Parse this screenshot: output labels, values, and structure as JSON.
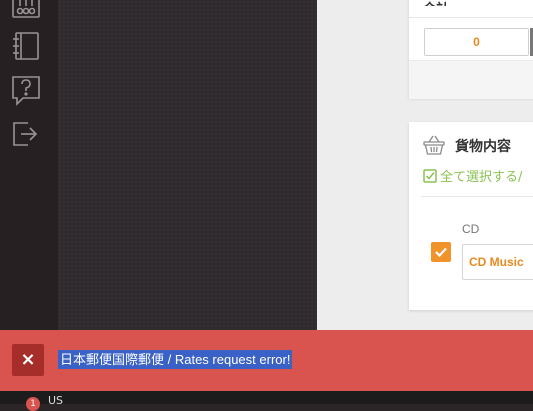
{
  "sidebar": {
    "icons": [
      "settings-sliders-icon",
      "notebook-icon",
      "help-question-icon",
      "logout-icon"
    ]
  },
  "panel_top": {
    "title_partial": "合計",
    "quantity_value": "0"
  },
  "cargo": {
    "title": "貨物内容",
    "select_all": "全て選択する/",
    "item": {
      "code": "CD",
      "name": "CD Music",
      "checked": true
    }
  },
  "alert": {
    "close_label": "×",
    "message": "日本郵便国際郵便 / Rates request error!"
  },
  "bottom": {
    "badge": "1",
    "text": "US"
  },
  "colors": {
    "accent_orange": "#f0932b",
    "alert_red": "#d9534f",
    "select_green": "#8cc152",
    "selection_blue": "#3a62c6"
  }
}
